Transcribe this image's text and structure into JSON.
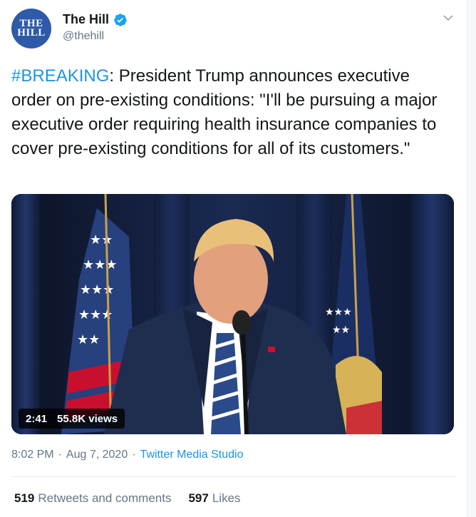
{
  "author": {
    "avatar_lines": [
      "THE",
      "HILL"
    ],
    "name": "The Hill",
    "handle": "@thehill",
    "verified": true
  },
  "tweet": {
    "hashtag": "#BREAKING",
    "text": ": President Trump announces executive order on pre-existing conditions: \"I'll be pursuing a major executive order requiring health insurance companies to cover pre-existing conditions for all of its customers.\""
  },
  "media": {
    "duration": "2:41",
    "views": "55.8K views"
  },
  "meta": {
    "time": "8:02 PM",
    "separator1": "·",
    "date": "Aug 7, 2020",
    "separator2": "·",
    "source": "Twitter Media Studio"
  },
  "stats": {
    "retweets_count": "519",
    "retweets_label": "Retweets and comments",
    "likes_count": "597",
    "likes_label": "Likes"
  },
  "colors": {
    "accent": "#1b95e0",
    "muted": "#657786",
    "avatar": "#2e5aa8"
  }
}
